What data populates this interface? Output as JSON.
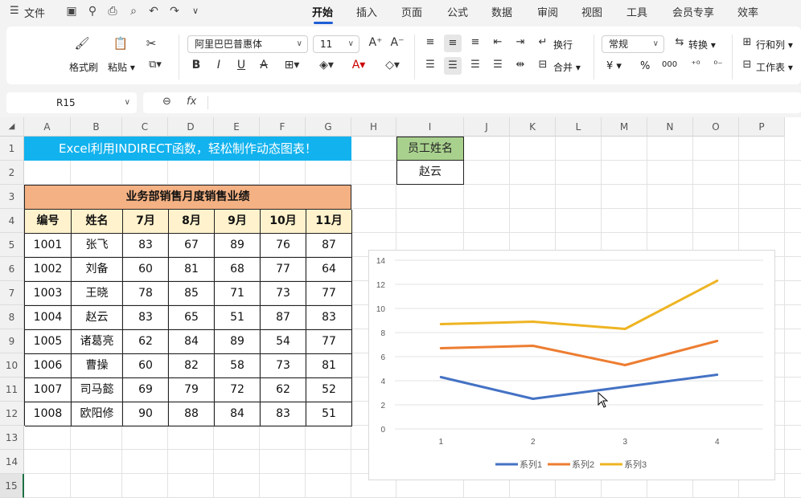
{
  "menu": {
    "app_menu": "文件"
  },
  "tabs": [
    {
      "label": "开始",
      "active": true
    },
    {
      "label": "插入"
    },
    {
      "label": "页面"
    },
    {
      "label": "公式"
    },
    {
      "label": "数据"
    },
    {
      "label": "审阅"
    },
    {
      "label": "视图"
    },
    {
      "label": "工具"
    },
    {
      "label": "会员专享"
    },
    {
      "label": "效率"
    }
  ],
  "ribbon": {
    "format_painter": "格式刷",
    "paste": "粘贴",
    "font_name": "阿里巴巴普惠体",
    "font_size": "11",
    "wrap": "换行",
    "merge": "合并",
    "number_format": "常规",
    "convert": "转换",
    "row_col": "行和列",
    "worksheet": "工作表",
    "bold": "B",
    "italic": "I",
    "underline": "U",
    "strike": "A",
    "percent": "%",
    "currency": "¥",
    "thousands": "000"
  },
  "formula_bar": {
    "name_box": "R15",
    "fx": "fx",
    "formula": ""
  },
  "columns": [
    "A",
    "B",
    "C",
    "D",
    "E",
    "F",
    "G",
    "H",
    "I",
    "J",
    "K",
    "L",
    "M",
    "N",
    "O",
    "P"
  ],
  "rows": [
    "1",
    "2",
    "3",
    "4",
    "5",
    "6",
    "7",
    "8",
    "9",
    "10",
    "11",
    "12",
    "13",
    "14",
    "15"
  ],
  "sheet": {
    "title": "Excel利用INDIRECT函数，轻松制作动态图表！",
    "table_title": "业务部销售月度销售业绩",
    "headers": [
      "编号",
      "姓名",
      "7月",
      "8月",
      "9月",
      "10月",
      "11月"
    ],
    "records": [
      [
        "1001",
        "张飞",
        "83",
        "67",
        "89",
        "76",
        "87"
      ],
      [
        "1002",
        "刘备",
        "60",
        "81",
        "68",
        "77",
        "64"
      ],
      [
        "1003",
        "王晓",
        "78",
        "85",
        "71",
        "73",
        "77"
      ],
      [
        "1004",
        "赵云",
        "83",
        "65",
        "51",
        "87",
        "83"
      ],
      [
        "1005",
        "诸葛亮",
        "62",
        "84",
        "89",
        "54",
        "77"
      ],
      [
        "1006",
        "曹操",
        "60",
        "82",
        "58",
        "73",
        "81"
      ],
      [
        "1007",
        "司马懿",
        "69",
        "79",
        "72",
        "62",
        "52"
      ],
      [
        "1008",
        "欧阳修",
        "90",
        "88",
        "84",
        "83",
        "51"
      ]
    ],
    "employee_label": "员工姓名",
    "employee_value": "赵云"
  },
  "colors": {
    "title_bg": "#12b2ee",
    "table_title_bg": "#f4b183",
    "header_bg": "#fff2cc",
    "emp_label_bg": "#a9d18e",
    "accent": "#1f5fd6"
  },
  "chart_data": {
    "type": "line",
    "x": [
      1,
      2,
      3,
      4
    ],
    "xlabels": [
      "1",
      "2",
      "3",
      "4"
    ],
    "yticks": [
      "0",
      "2",
      "4",
      "6",
      "8",
      "10",
      "12",
      "14"
    ],
    "ylim": [
      0,
      14
    ],
    "grid": true,
    "legend_position": "bottom",
    "series": [
      {
        "name": "系列1",
        "color": "#4472c4",
        "values": [
          4.3,
          2.5,
          3.5,
          4.5
        ]
      },
      {
        "name": "系列2",
        "color": "#ed7d31",
        "values": [
          6.7,
          6.9,
          5.3,
          7.3
        ]
      },
      {
        "name": "系列3",
        "color": "#eeb422",
        "values": [
          8.7,
          8.9,
          8.3,
          12.3
        ]
      }
    ]
  }
}
